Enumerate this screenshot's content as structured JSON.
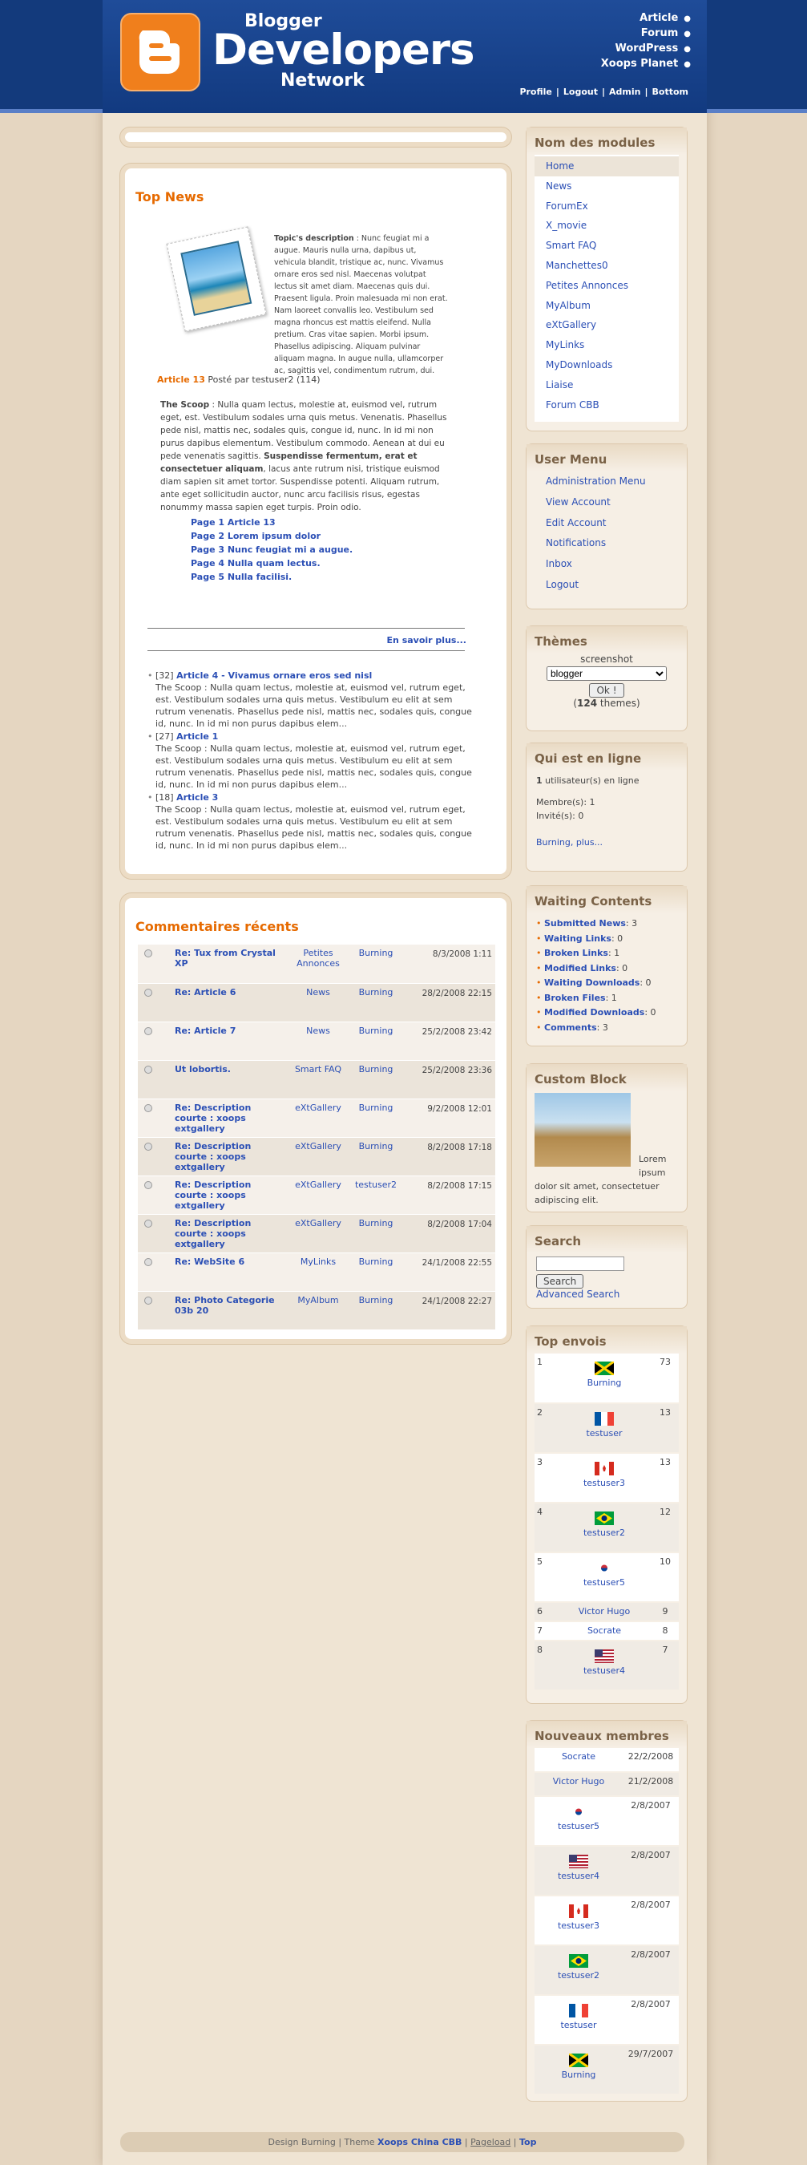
{
  "header": {
    "logo_line1": "Blogger",
    "logo_line2": "Developers",
    "logo_line3": "Network",
    "nav": [
      "Article",
      "Forum",
      "WordPress",
      "Xoops Planet"
    ],
    "user_nav": [
      "Profile",
      "Logout",
      "Admin",
      "Bottom"
    ]
  },
  "topnews": {
    "title": "Top News",
    "desc_label": "Topic's description",
    "desc_text": " : Nunc feugiat mi a augue. Mauris nulla urna, dapibus ut, vehicula blandit, tristique ac, nunc. Vivamus ornare eros sed nisl. Maecenas volutpat lectus sit amet diam. Maecenas quis dui. Praesent ligula. Proin malesuada mi non erat. Nam laoreet convallis leo. Vestibulum sed magna rhoncus est mattis eleifend. Nulla pretium. Cras vitae sapien. Morbi ipsum. Phasellus adipiscing. Aliquam pulvinar aliquam magna. In augue nulla, ullamcorper ac, sagittis vel, condimentum rutrum, dui.",
    "article_title": "Article 13",
    "article_meta": " Posté par testuser2 (114)",
    "scoop_label": "The Scoop",
    "scoop_text": " : Nulla quam lectus, molestie at, euismod vel, rutrum eget, est. Vestibulum sodales urna quis metus. Venenatis. Phasellus pede nisl, mattis nec, sodales quis, congue id, nunc. In id mi non purus dapibus elementum. Vestibulum commodo. Aenean at dui eu pede venenatis sagittis. ",
    "scoop_bold": "Suspendisse fermentum, erat et consectetuer aliquam",
    "scoop_tail": ", lacus ante rutrum nisi, tristique euismod diam sapien sit amet tortor. Suspendisse potenti. Aliquam rutrum, ante eget sollicitudin auctor, nunc arcu facilisis risus, egestas nonummy massa sapien eget turpis. Proin odio.",
    "pages": [
      "Page 1 Article 13",
      "Page 2 Lorem ipsum dolor",
      "Page 3 Nunc feugiat mi a augue.",
      "Page 4 Nulla quam lectus.",
      "Page 5 Nulla facilisi."
    ],
    "more": "En savoir plus...",
    "list": [
      {
        "num": "[32]",
        "title": "Article 4 - Vivamus ornare eros sed nisl",
        "text": "The Scoop : Nulla quam lectus, molestie at, euismod vel, rutrum eget, est. Vestibulum sodales urna quis metus. Vestibulum eu elit at sem rutrum venenatis. Phasellus pede nisl, mattis nec, sodales quis, congue id, nunc. In id mi non purus dapibus elem..."
      },
      {
        "num": "[27]",
        "title": "Article 1",
        "text": "The Scoop : Nulla quam lectus, molestie at, euismod vel, rutrum eget, est. Vestibulum sodales urna quis metus. Vestibulum eu elit at sem rutrum venenatis. Phasellus pede nisl, mattis nec, sodales quis, congue id, nunc. In id mi non purus dapibus elem..."
      },
      {
        "num": "[18]",
        "title": "Article 3",
        "text": "The Scoop : Nulla quam lectus, molestie at, euismod vel, rutrum eget, est. Vestibulum sodales urna quis metus. Vestibulum eu elit at sem rutrum venenatis. Phasellus pede nisl, mattis nec, sodales quis, congue id, nunc. In id mi non purus dapibus elem..."
      }
    ]
  },
  "comments": {
    "title": "Commentaires récents",
    "rows": [
      {
        "title": "Re: Tux from Crystal XP",
        "module": "Petites Annonces",
        "user": "Burning",
        "date": "8/3/2008 1:11"
      },
      {
        "title": "Re: Article 6",
        "module": "News",
        "user": "Burning",
        "date": "28/2/2008 22:15"
      },
      {
        "title": "Re: Article 7",
        "module": "News",
        "user": "Burning",
        "date": "25/2/2008 23:42"
      },
      {
        "title": "Ut lobortis.",
        "module": "Smart FAQ",
        "user": "Burning",
        "date": "25/2/2008 23:36"
      },
      {
        "title": "Re: Description courte : xoops extgallery",
        "module": "eXtGallery",
        "user": "Burning",
        "date": "9/2/2008 12:01"
      },
      {
        "title": "Re: Description courte : xoops extgallery",
        "module": "eXtGallery",
        "user": "Burning",
        "date": "8/2/2008 17:18"
      },
      {
        "title": "Re: Description courte : xoops extgallery",
        "module": "eXtGallery",
        "user": "testuser2",
        "date": "8/2/2008 17:15"
      },
      {
        "title": "Re: Description courte : xoops extgallery",
        "module": "eXtGallery",
        "user": "Burning",
        "date": "8/2/2008 17:04"
      },
      {
        "title": "Re: WebSite 6",
        "module": "MyLinks",
        "user": "Burning",
        "date": "24/1/2008 22:55"
      },
      {
        "title": "Re: Photo Categorie 03b 20",
        "module": "MyAlbum",
        "user": "Burning",
        "date": "24/1/2008 22:27"
      }
    ]
  },
  "modules": {
    "title": "Nom des modules",
    "items": [
      "Home",
      "News",
      "ForumEx",
      "X_movie",
      "Smart FAQ",
      "Manchettes0",
      "Petites Annonces",
      "MyAlbum",
      "eXtGallery",
      "MyLinks",
      "MyDownloads",
      "Liaise",
      "Forum CBB"
    ]
  },
  "usermenu": {
    "title": "User Menu",
    "items": [
      "Administration Menu",
      "View Account",
      "Edit Account",
      "Notifications",
      "Inbox",
      "Logout"
    ]
  },
  "themes": {
    "title": "Thèmes",
    "screenshot": "screenshot",
    "selected": "blogger",
    "ok": "Ok !",
    "count_pre": "(",
    "count": "124",
    "count_post": " themes)"
  },
  "online": {
    "title": "Qui est en ligne",
    "line1_num": "1",
    "line1": " utilisateur(s) en ligne",
    "members": "Membre(s): 1",
    "guests": "Invité(s): 0",
    "more": "Burning, plus..."
  },
  "waiting": {
    "title": "Waiting Contents",
    "items": [
      {
        "label": "Submitted News",
        "value": ": 3"
      },
      {
        "label": "Waiting Links",
        "value": ": 0"
      },
      {
        "label": "Broken Links",
        "value": ": 1"
      },
      {
        "label": "Modified Links",
        "value": ": 0"
      },
      {
        "label": "Waiting Downloads",
        "value": ": 0"
      },
      {
        "label": "Broken Files",
        "value": ": 1"
      },
      {
        "label": "Modified Downloads",
        "value": ": 0"
      },
      {
        "label": "Comments",
        "value": ": 3"
      }
    ]
  },
  "custom": {
    "title": "Custom Block",
    "text": "Lorem ipsum dolor sit amet, consectetuer adipiscing elit."
  },
  "search": {
    "title": "Search",
    "button": "Search",
    "advanced": "Advanced Search"
  },
  "topenvois": {
    "title": "Top envois",
    "rows": [
      {
        "rank": "1",
        "user": "Burning",
        "count": "73",
        "flag": "jamaica"
      },
      {
        "rank": "2",
        "user": "testuser",
        "count": "13",
        "flag": "france"
      },
      {
        "rank": "3",
        "user": "testuser3",
        "count": "13",
        "flag": "canada"
      },
      {
        "rank": "4",
        "user": "testuser2",
        "count": "12",
        "flag": "brazil"
      },
      {
        "rank": "5",
        "user": "testuser5",
        "count": "10",
        "flag": "korea"
      },
      {
        "rank": "6",
        "user": "Victor Hugo",
        "count": "9",
        "flag": ""
      },
      {
        "rank": "7",
        "user": "Socrate",
        "count": "8",
        "flag": ""
      },
      {
        "rank": "8",
        "user": "testuser4",
        "count": "7",
        "flag": "usa"
      }
    ]
  },
  "nouveaux": {
    "title": "Nouveaux membres",
    "rows": [
      {
        "user": "Socrate",
        "date": "22/2/2008",
        "flag": ""
      },
      {
        "user": "Victor Hugo",
        "date": "21/2/2008",
        "flag": ""
      },
      {
        "user": "testuser5",
        "date": "2/8/2007",
        "flag": "korea"
      },
      {
        "user": "testuser4",
        "date": "2/8/2007",
        "flag": "usa"
      },
      {
        "user": "testuser3",
        "date": "2/8/2007",
        "flag": "canada"
      },
      {
        "user": "testuser2",
        "date": "2/8/2007",
        "flag": "brazil"
      },
      {
        "user": "testuser",
        "date": "2/8/2007",
        "flag": "france"
      },
      {
        "user": "Burning",
        "date": "29/7/2007",
        "flag": "jamaica"
      }
    ]
  },
  "footer": {
    "design": "Design Burning",
    "theme_pre": "Theme",
    "theme": "Xoops China CBB",
    "pageload": "Pageload",
    "top": "Top"
  }
}
